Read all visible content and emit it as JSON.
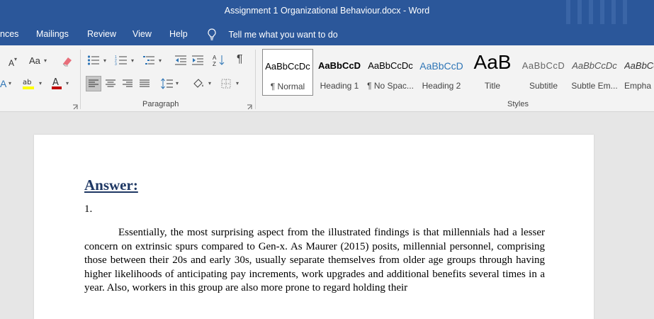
{
  "window": {
    "title": "Assignment 1 Organizational Behaviour.docx  -  Word"
  },
  "tabs": [
    "nces",
    "Mailings",
    "Review",
    "View",
    "Help"
  ],
  "tell_me": "Tell me what you want to do",
  "ribbon": {
    "font": {
      "font_size_grow": "A",
      "change_case": "Aa"
    },
    "paragraph": {
      "label": "Paragraph"
    },
    "styles": {
      "label": "Styles",
      "items": [
        {
          "sample": "AaBbCcDc",
          "name": "¶ Normal"
        },
        {
          "sample": "AaBbCcD",
          "name": "Heading 1"
        },
        {
          "sample": "AaBbCcDc",
          "name": "¶ No Spac..."
        },
        {
          "sample": "AaBbCcD",
          "name": "Heading 2"
        },
        {
          "sample": "AaB",
          "name": "Title"
        },
        {
          "sample": "AaBbCcD",
          "name": "Subtitle"
        },
        {
          "sample": "AaBbCcDc",
          "name": "Subtle Em..."
        },
        {
          "sample": "AaBbCcDc",
          "name": "Empha"
        }
      ]
    }
  },
  "colors": {
    "accent": "#2b579a",
    "answer_heading": "#1f3864"
  },
  "document": {
    "heading": "Answer:",
    "number": "1.",
    "paragraph": "Essentially, the most surprising aspect from the illustrated findings is that millennials had a lesser concern on extrinsic spurs compared to Gen-x. As Maurer (2015) posits, millennial personnel, comprising those between their 20s and early 30s, usually separate themselves from older age groups through having higher likelihoods of anticipating pay increments, work upgrades and additional benefits several times in a year. Also, workers in this group are also more prone to regard holding their"
  }
}
